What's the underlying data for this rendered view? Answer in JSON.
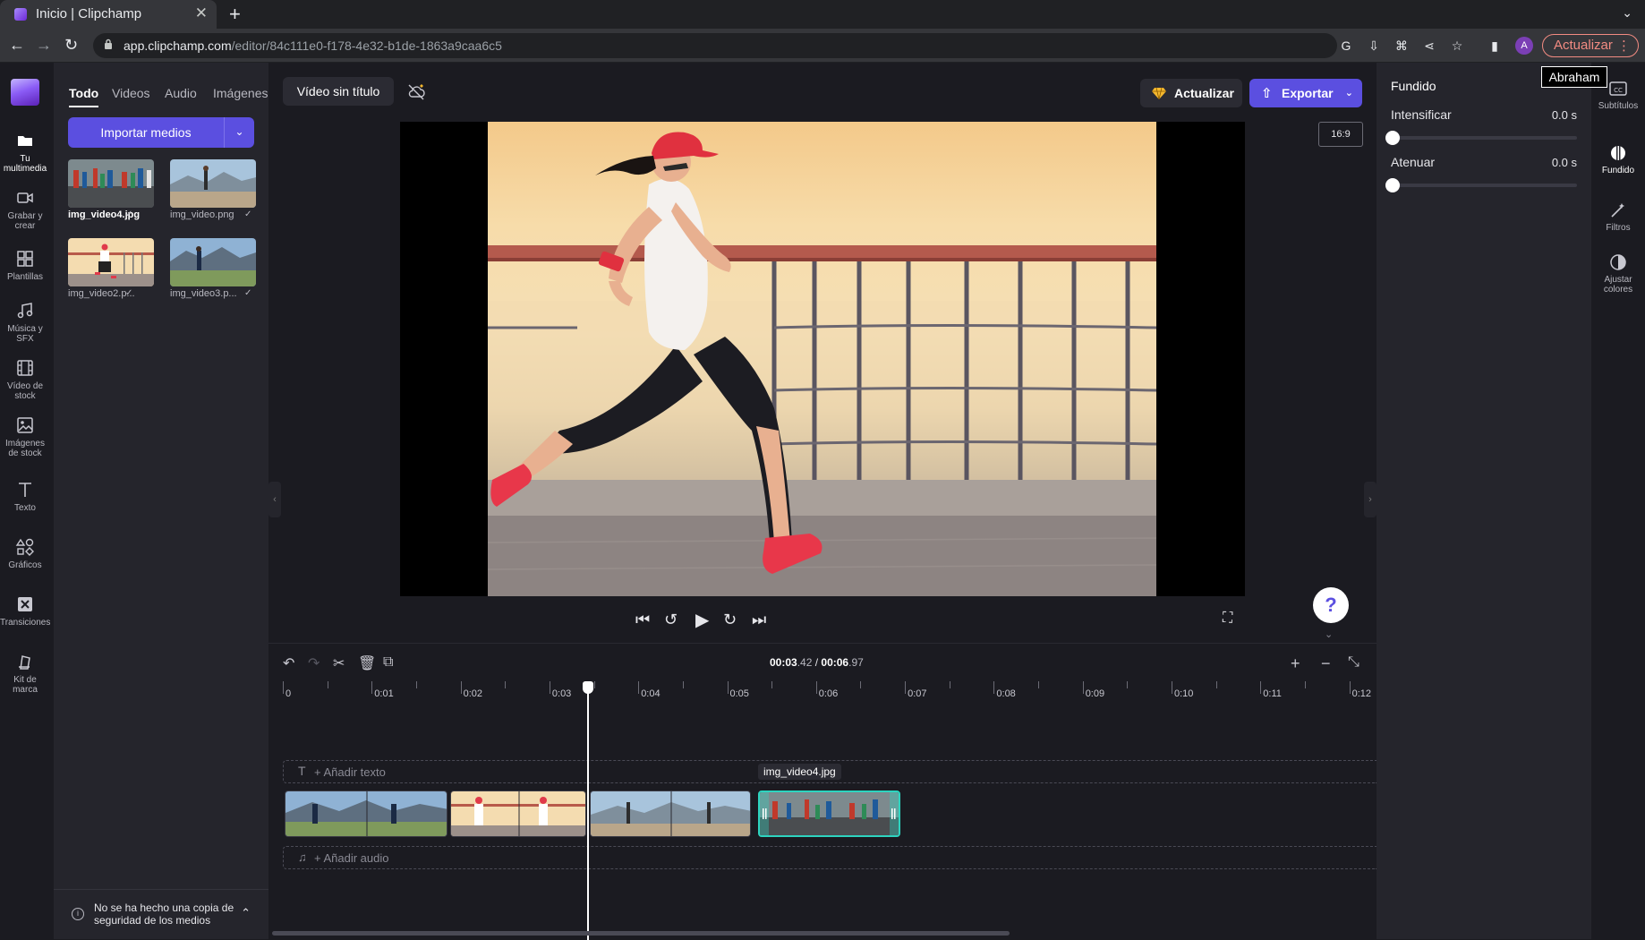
{
  "browser": {
    "tab_title": "Inicio | Clipchamp",
    "url_host": "app.clipchamp.com",
    "url_path": "/editor/84c111e0-f178-4e32-b1de-1863a9caa6c5",
    "update_label": "Actualizar",
    "avatar_letter": "A",
    "user_tooltip": "Abraham"
  },
  "leftnav": {
    "items": [
      {
        "label": "Tu multimedia",
        "icon": "folder-icon"
      },
      {
        "label": "Grabar y crear",
        "icon": "camera-icon"
      },
      {
        "label": "Plantillas",
        "icon": "templates-icon"
      },
      {
        "label": "Música y SFX",
        "icon": "music-icon"
      },
      {
        "label": "Vídeo de stock",
        "icon": "film-icon"
      },
      {
        "label": "Imágenes de stock",
        "icon": "image-icon"
      },
      {
        "label": "Texto",
        "icon": "text-icon"
      },
      {
        "label": "Gráficos",
        "icon": "shapes-icon"
      },
      {
        "label": "Transiciones",
        "icon": "transitions-icon"
      },
      {
        "label": "Kit de marca",
        "icon": "brand-kit-icon"
      }
    ]
  },
  "media": {
    "tabs": [
      "Todo",
      "Videos",
      "Audio",
      "Imágenes"
    ],
    "import_label": "Importar medios",
    "items": [
      {
        "name": "img_video4.jpg"
      },
      {
        "name": "img_video.png"
      },
      {
        "name": "img_video2.p..."
      },
      {
        "name": "img_video3.p..."
      }
    ],
    "backup_notice": "No se ha hecho una copia de seguridad de los medios"
  },
  "editor": {
    "video_title": "Vídeo sin título",
    "update_label": "Actualizar",
    "export_label": "Exportar",
    "aspect_ratio": "16:9"
  },
  "timeline": {
    "current": "00:03",
    "current_ms": ".42",
    "separator": " / ",
    "total": "00:06",
    "total_ms": ".97",
    "ticks": [
      "0",
      "0:01",
      "0:02",
      "0:03",
      "0:04",
      "0:05",
      "0:06",
      "0:07",
      "0:08",
      "0:09",
      "0:10",
      "0:11",
      "0:12"
    ],
    "add_text": "+ Añadir texto",
    "add_audio": "+ Añadir audio",
    "clip_tooltip": "img_video4.jpg"
  },
  "fade": {
    "title": "Fundido",
    "fade_in_label": "Intensificar",
    "fade_in_value": "0.0 s",
    "fade_out_label": "Atenuar",
    "fade_out_value": "0.0 s"
  },
  "rightrail": {
    "items": [
      {
        "label": "Subtítulos",
        "icon": "captions-icon"
      },
      {
        "label": "Fundido",
        "icon": "fade-icon"
      },
      {
        "label": "Filtros",
        "icon": "magic-wand-icon"
      },
      {
        "label": "Ajustar colores",
        "icon": "contrast-icon"
      }
    ]
  },
  "colors": {
    "accent": "#5b4fe0",
    "selection": "#2dd4bf"
  }
}
